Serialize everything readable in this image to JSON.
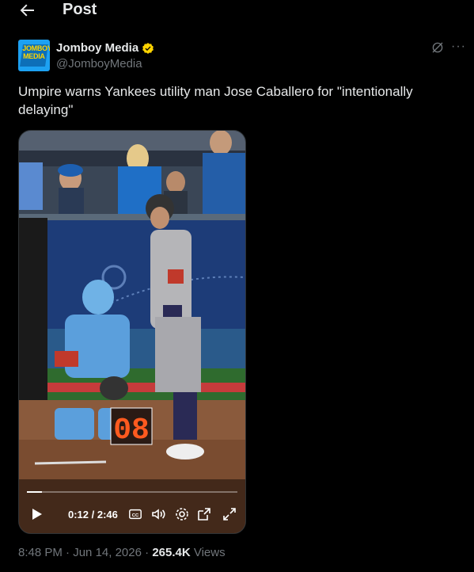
{
  "header": {
    "title": "Post",
    "back_icon": "arrow-left-icon"
  },
  "author": {
    "name": "Jomboy Media",
    "handle": "@JomboyMedia",
    "avatar_text": [
      "JOMBOY",
      "MEDIA"
    ],
    "verified": true,
    "verified_color": "#ffd400"
  },
  "tweet": {
    "text": "Umpire warns Yankees utility man Jose Caballero for \"intentionally delaying\""
  },
  "video": {
    "current_time": "0:12",
    "duration": "2:46",
    "time_display": "0:12 / 2:46",
    "progress_fraction": 0.072,
    "pitch_clock": "08",
    "controls": [
      "play-icon",
      "captions-icon",
      "volume-icon",
      "settings-icon",
      "popout-icon",
      "fullscreen-icon"
    ]
  },
  "meta": {
    "time": "8:48 PM",
    "separator": "·",
    "date": "Jun 14, 2026",
    "views_count": "265.4K",
    "views_label": "Views"
  },
  "colors": {
    "background": "#000000",
    "text": "#e7e9ea",
    "secondary": "#71767b",
    "border": "#2f3336"
  }
}
